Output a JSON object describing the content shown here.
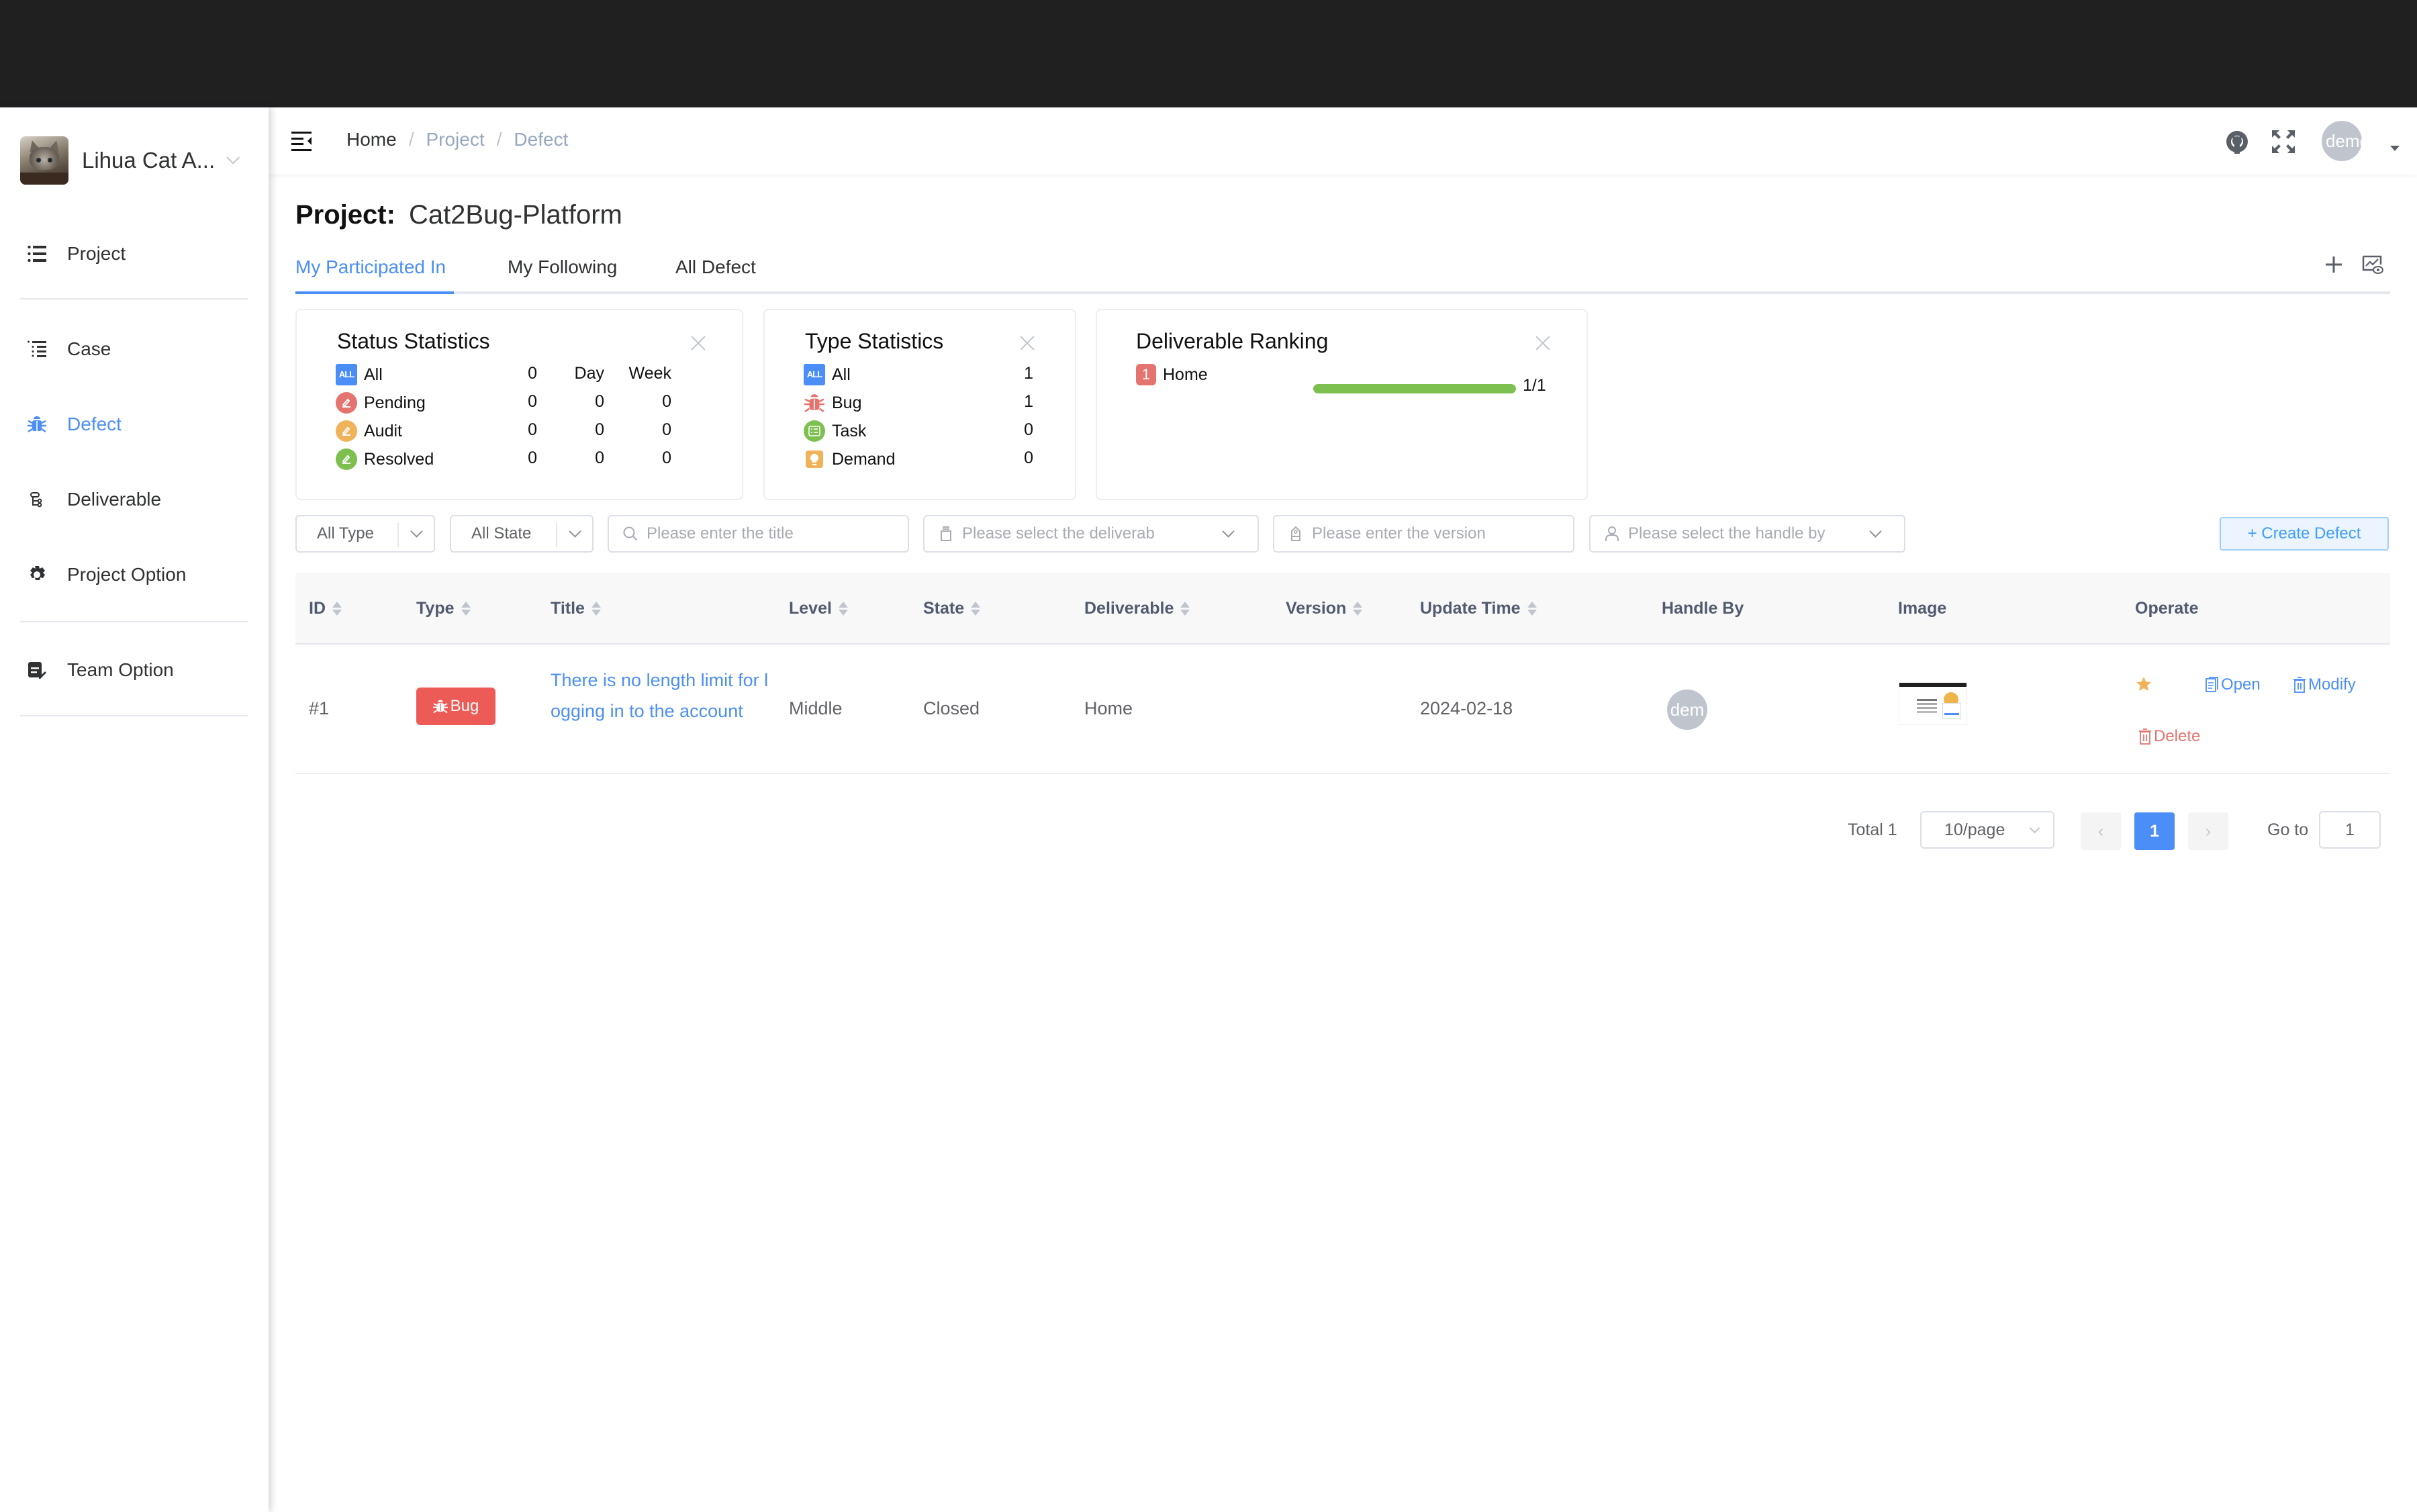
{
  "sidebar": {
    "brand_title": "Lihua Cat A...",
    "items": [
      {
        "label": "Project",
        "icon": "list-icon",
        "active": false
      },
      {
        "label": "Case",
        "icon": "case-list-icon",
        "active": false
      },
      {
        "label": "Defect",
        "icon": "bug-icon",
        "active": true
      },
      {
        "label": "Deliverable",
        "icon": "tree-icon",
        "active": false
      },
      {
        "label": "Project Option",
        "icon": "gear-icon",
        "active": false
      },
      {
        "label": "Team Option",
        "icon": "team-edit-icon",
        "active": false
      }
    ]
  },
  "navbar": {
    "breadcrumb": [
      "Home",
      "Project",
      "Defect"
    ],
    "avatar_text": "demo"
  },
  "project": {
    "label": "Project:",
    "name": "Cat2Bug-Platform"
  },
  "tabs": [
    {
      "label": "My Participated In",
      "active": true
    },
    {
      "label": "My Following",
      "active": false
    },
    {
      "label": "All Defect",
      "active": false
    }
  ],
  "status_statistics": {
    "title": "Status Statistics",
    "col_day": "Day",
    "col_week": "Week",
    "rows": [
      {
        "label": "All",
        "total": "0",
        "day": "",
        "week": "",
        "color": "#4b8ef7"
      },
      {
        "label": "Pending",
        "total": "0",
        "day": "0",
        "week": "0",
        "color": "#e5736f"
      },
      {
        "label": "Audit",
        "total": "0",
        "day": "0",
        "week": "0",
        "color": "#f0b35a"
      },
      {
        "label": "Resolved",
        "total": "0",
        "day": "0",
        "week": "0",
        "color": "#7dc050"
      }
    ]
  },
  "type_statistics": {
    "title": "Type Statistics",
    "rows": [
      {
        "label": "All",
        "count": "1",
        "color": "#4b8ef7"
      },
      {
        "label": "Bug",
        "count": "1",
        "color": "#e5736f"
      },
      {
        "label": "Task",
        "count": "0",
        "color": "#7dc050"
      },
      {
        "label": "Demand",
        "count": "0",
        "color": "#f0b35a"
      }
    ]
  },
  "deliverable_ranking": {
    "title": "Deliverable Ranking",
    "rows": [
      {
        "rank": "1",
        "name": "Home",
        "ratio_text": "1/1",
        "progress": 1.0
      }
    ]
  },
  "filters": {
    "type_select": "All Type",
    "state_select": "All State",
    "title_placeholder": "Please enter the title",
    "deliverable_placeholder": "Please select the deliverab",
    "version_placeholder": "Please enter the version",
    "handle_placeholder": "Please select the handle by",
    "create_button": "+ Create Defect"
  },
  "table": {
    "columns": [
      "ID",
      "Type",
      "Title",
      "Level",
      "State",
      "Deliverable",
      "Version",
      "Update Time",
      "Handle By",
      "Image",
      "Operate"
    ],
    "rows": [
      {
        "id": "#1",
        "type": "Bug",
        "title": "There is no length limit for logging in to the account",
        "level": "Middle",
        "state": "Closed",
        "deliverable": "Home",
        "version": "",
        "update_time": "2024-02-18",
        "handle_by": "dem",
        "ops": {
          "open": "Open",
          "modify": "Modify",
          "delete": "Delete"
        }
      }
    ]
  },
  "pagination": {
    "total": "Total 1",
    "page_size": "10/page",
    "current_page": "1",
    "goto_label": "Go to",
    "goto_value": "1"
  },
  "colors": {
    "accent": "#4b8ef7",
    "danger": "#ec5b56",
    "success": "#7dc050",
    "warning": "#f0b35a"
  }
}
